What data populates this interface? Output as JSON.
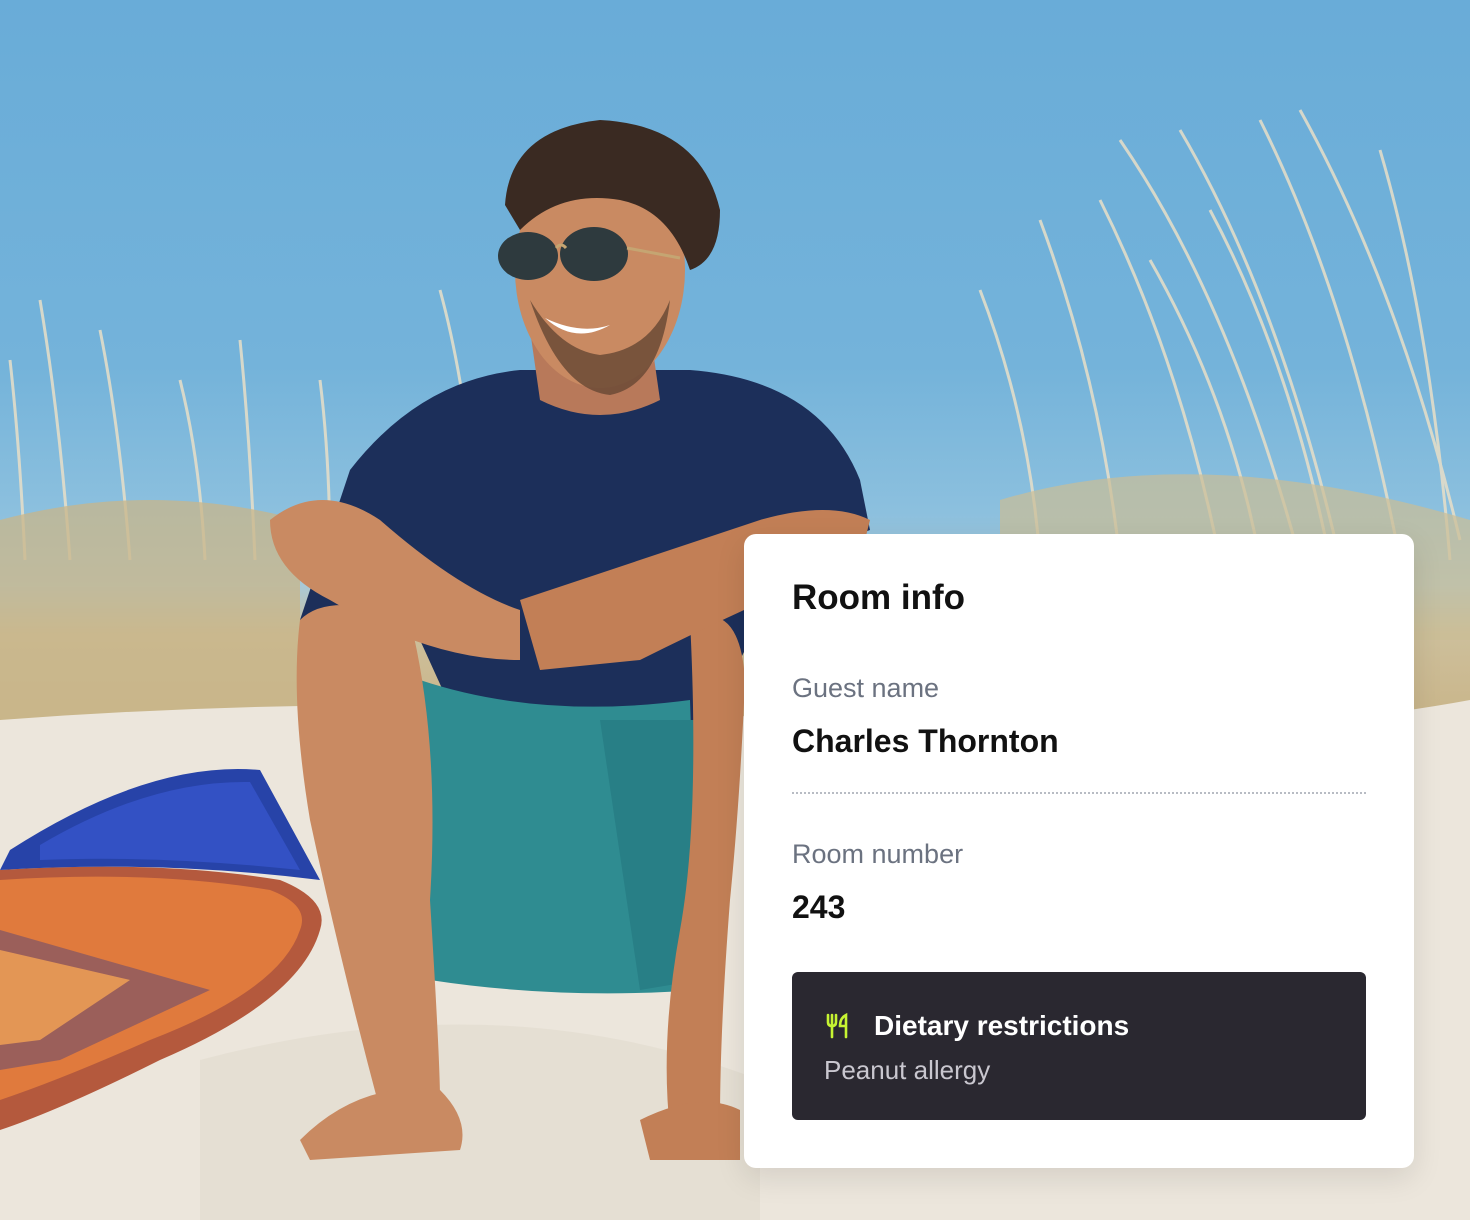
{
  "photo": {
    "description_icon": "beach-photo"
  },
  "room_info": {
    "title": "Room info",
    "guest_name_label": "Guest name",
    "guest_name_value": "Charles Thornton",
    "room_number_label": "Room number",
    "room_number_value": "243",
    "dietary": {
      "icon": "fork-knife-icon",
      "title": "Dietary restrictions",
      "value": "Peanut allergy",
      "accent_color": "#c6f432",
      "background_color": "#2a2830"
    }
  }
}
